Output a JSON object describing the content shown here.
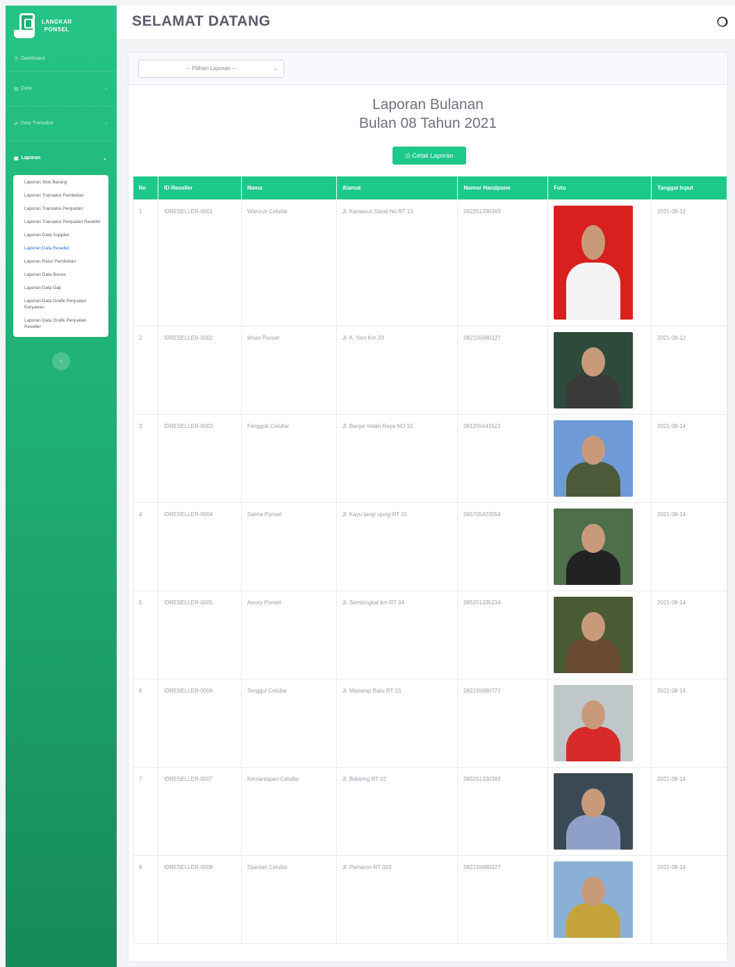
{
  "brand": {
    "line1": "LANGKAR",
    "line2": "PONSEL"
  },
  "sidebar": {
    "items": [
      {
        "label": "Dashboard",
        "icon": "dashboard-icon"
      },
      {
        "label": "Data",
        "icon": "folder-icon"
      },
      {
        "label": "Data Transaksi",
        "icon": "transaction-icon"
      },
      {
        "label": "Laporan",
        "icon": "print-icon"
      }
    ],
    "submenu": [
      "Laporan Stok Barang",
      "Laporan Transaksi Pembelian",
      "Laporan Transaksi Penjualan",
      "Laporan Transaksi Penjualan Reseller",
      "Laporan Data Supplier",
      "Laporan Data Reseller",
      "Laporan Retur Pembelian",
      "Laporan Data Bonus",
      "Laporan Data Gaji",
      "Laporan Data Grafik Penjualan Karyawan",
      "Laporan Data Grafik Penjualan Reseller"
    ],
    "toggle": "‹"
  },
  "topbar": {
    "title": "SELAMAT DATANG",
    "user_icon": "user-icon"
  },
  "filter": {
    "placeholder": "-- Pilihan Laporan --"
  },
  "report": {
    "title": "Laporan Bulanan",
    "subtitle": "Bulan 08  Tahun 2021",
    "print_label": "Cetak Laporan"
  },
  "table": {
    "headers": [
      "No",
      "ID Reseller",
      "Nama",
      "Alamat",
      "Nomor Handpone",
      "Foto",
      "Tanggal Input"
    ],
    "rows": [
      {
        "no": "1",
        "id": "IDRESELLER-0001",
        "nama": "Wanzuh Celullar",
        "alamat": "Jl. Kamasuri Darat No RT 13",
        "hp": "082251330393",
        "tanggal": "2021-08-12",
        "bg": "#d8201e",
        "body": "#f4f4f4"
      },
      {
        "no": "2",
        "id": "IDRESELLER-0002",
        "nama": "Ikhan Ponsel",
        "alamat": "Jl. A. Yani Km 23",
        "hp": "082155680227",
        "tanggal": "2021-08-12",
        "bg": "#2e4a3a",
        "body": "#3a3a3a"
      },
      {
        "no": "3",
        "id": "IDRESELLER-0003",
        "nama": "Fenggok Celullar",
        "alamat": "Jl. Banjar Indah Raya NO 15",
        "hp": "081255441521",
        "tanggal": "2021-08-14",
        "bg": "#6f9bd6",
        "body": "#4c5a3a"
      },
      {
        "no": "4",
        "id": "IDRESELLER-0004",
        "nama": "Salma Ponsel",
        "alamat": "Jl. Kayu tangi ujung RT 21",
        "hp": "085705423554",
        "tanggal": "2021-08-14",
        "bg": "#4d6f4a",
        "body": "#222"
      },
      {
        "no": "5",
        "id": "IDRESELLER-0005",
        "nama": "Aisory Ponsel",
        "alamat": "Jl. Sembingkat km RT 34",
        "hp": "085251335234",
        "tanggal": "2021-08-14",
        "bg": "#4a5a34",
        "body": "#6a4a30"
      },
      {
        "no": "6",
        "id": "IDRESELLER-0006",
        "nama": "Tanggul Celullar",
        "alamat": "Jl. Manarap Baru RT 15",
        "hp": "082155680772",
        "tanggal": "2021-08-14",
        "bg": "#bfc7c9",
        "body": "#d82a2a"
      },
      {
        "no": "7",
        "id": "IDRESELLER-0007",
        "nama": "Kemantapan Celullar",
        "alamat": "Jl. Babbing RT 02",
        "hp": "085251330393",
        "tanggal": "2021-08-14",
        "bg": "#3a4a54",
        "body": "#8fa0c8"
      },
      {
        "no": "8",
        "id": "IDRESELLER-0008",
        "nama": "Sijantan Celullar",
        "alamat": "Jl. Pemaron RT 003",
        "hp": "082155680227",
        "tanggal": "2021-08-14",
        "bg": "#8ab0d6",
        "body": "#c4a43a"
      }
    ]
  }
}
